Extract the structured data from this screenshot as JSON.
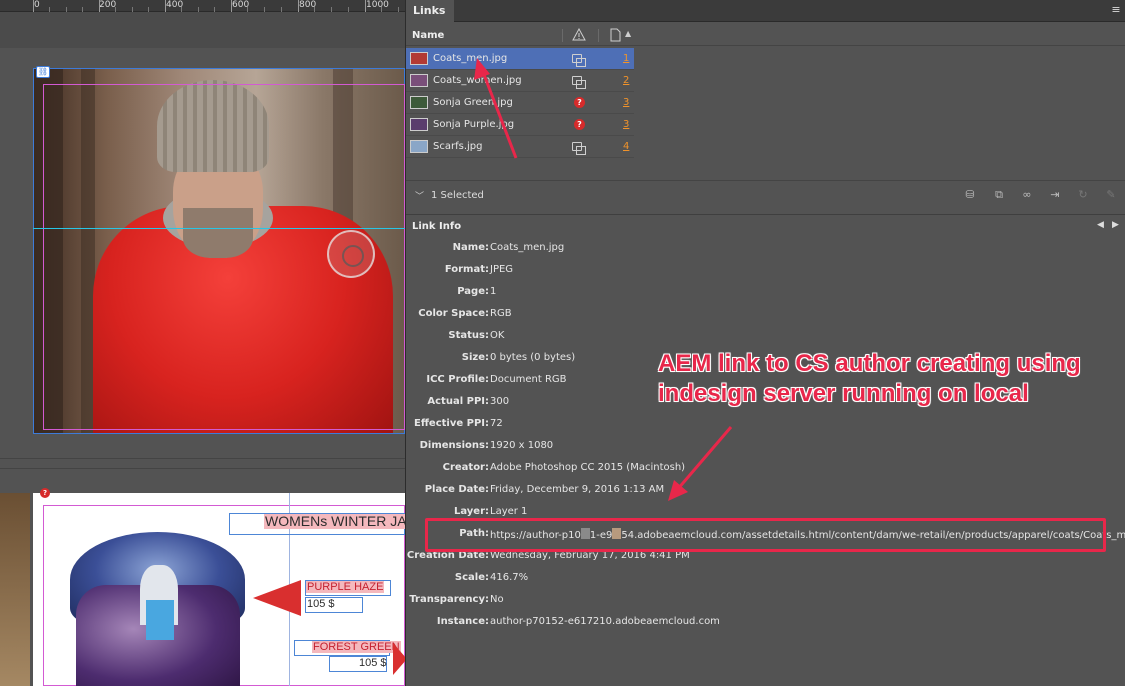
{
  "ruler": {
    "labels": [
      "0",
      "200",
      "400",
      "600",
      "800",
      "1000"
    ]
  },
  "canvas": {
    "page2": {
      "title": "WOMENs WINTER JA",
      "product1_name": "PURPLE HAZE",
      "product1_price": "105 $",
      "product2_name": "FOREST GREEN",
      "product2_price": "105 $"
    }
  },
  "panel": {
    "tab_label": "Links",
    "menu_icon": "panel-menu-icon",
    "header": {
      "name_col": "Name",
      "warning_col_icon": "warning-icon",
      "page_col_icon": "page-icon"
    },
    "links": [
      {
        "name": "Coats_men.jpg",
        "status": "ok",
        "page": "1",
        "selected": true,
        "thumb_color": "#b33a34"
      },
      {
        "name": "Coats_women.jpg",
        "status": "ok",
        "page": "2",
        "selected": false,
        "thumb_color": "#7a4f7a"
      },
      {
        "name": "Sonja Green.jpg",
        "status": "missing",
        "page": "3",
        "selected": false,
        "thumb_color": "#3d5a3a"
      },
      {
        "name": "Sonja Purple.jpg",
        "status": "missing",
        "page": "3",
        "selected": false,
        "thumb_color": "#5a3d6d"
      },
      {
        "name": "Scarfs.jpg",
        "status": "ok",
        "page": "4",
        "selected": false,
        "thumb_color": "#8aa6c7"
      }
    ],
    "selection_text": "1 Selected",
    "toolbar_icons": [
      "relink-from-cc-icon",
      "relink-icon",
      "go-to-link-icon",
      "embed-icon",
      "update-link-icon",
      "edit-original-icon"
    ],
    "link_info_title": "Link Info",
    "link_info": [
      {
        "label": "Name:",
        "value": "Coats_men.jpg"
      },
      {
        "label": "Format:",
        "value": "JPEG"
      },
      {
        "label": "Page:",
        "value": "1"
      },
      {
        "label": "Color Space:",
        "value": "RGB"
      },
      {
        "label": "Status:",
        "value": "OK"
      },
      {
        "label": "Size:",
        "value": "0 bytes (0 bytes)"
      },
      {
        "label": "ICC Profile:",
        "value": "Document RGB"
      },
      {
        "label": "Actual PPI:",
        "value": "300"
      },
      {
        "label": "Effective PPI:",
        "value": "72"
      },
      {
        "label": "Dimensions:",
        "value": "1920 x 1080"
      },
      {
        "label": "Creator:",
        "value": "Adobe Photoshop CC 2015 (Macintosh)"
      },
      {
        "label": "Place Date:",
        "value": "Friday, December 9, 2016 1:13 AM"
      },
      {
        "label": "Layer:",
        "value": "Layer 1"
      },
      {
        "label": "Path:",
        "value_pre": "https://author-p10",
        "value_mid1": "1-e9",
        "value_post": "54.adobeaemcloud.com/assetdetails.html/content/dam/we-retail/en/products/apparel/coats/Coats_men.jpg"
      },
      {
        "label": "Creation Date:",
        "value": "Wednesday, February 17, 2016 4:41 PM"
      },
      {
        "label": "Scale:",
        "value": "416.7%"
      },
      {
        "label": "Transparency:",
        "value": "No"
      },
      {
        "label": "Instance:",
        "value": "author-p70152-e617210.adobeaemcloud.com"
      }
    ]
  },
  "annotation": {
    "text": "AEM link to CS author creating using indesign server running on local",
    "color": "#e8274a"
  },
  "colors": {
    "selection": "#4e6fb6",
    "page_link": "#f0932b",
    "missing": "#d62b2b",
    "frame": "#3d7bd9",
    "margin": "#d35ad3"
  }
}
